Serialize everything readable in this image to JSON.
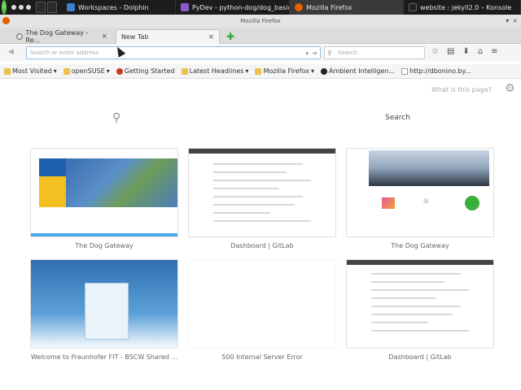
{
  "taskbar": {
    "tasks": [
      {
        "label": "Workspaces - Dolphin",
        "color": "#3f7fd0"
      },
      {
        "label": "PyDev - python-dog/dog_basic",
        "color": "#8a5ad0"
      },
      {
        "label": "Mozilla Firefox",
        "color": "#e66000",
        "active": true
      },
      {
        "label": "website : jekyll2.0 – Konsole",
        "color": "#222222"
      }
    ]
  },
  "window": {
    "title": "Mozilla Firefox"
  },
  "tabs": [
    {
      "label": "The Dog Gateway - Re...",
      "close": "×"
    },
    {
      "label": "New Tab",
      "close": "×"
    }
  ],
  "newtab_symbol": "✚",
  "navbar": {
    "url_placeholder": "Search or enter address",
    "search_placeholder": "Search"
  },
  "bookmarks": [
    {
      "label": "Most Visited",
      "icon": "folder",
      "dropdown": "▾"
    },
    {
      "label": "openSUSE",
      "icon": "folder",
      "dropdown": "▾"
    },
    {
      "label": "Getting Started",
      "icon": "red"
    },
    {
      "label": "Latest Headlines",
      "icon": "folder",
      "dropdown": "▾"
    },
    {
      "label": "Mozilla Firefox",
      "icon": "folder",
      "dropdown": "▾"
    },
    {
      "label": "Ambient Intelligen...",
      "icon": "gh"
    },
    {
      "label": "http://dbonino.by...",
      "icon": "page"
    }
  ],
  "newtab": {
    "whatis": "What is this page?",
    "search_label": "Search",
    "tiles": [
      {
        "label": "The Dog Gateway"
      },
      {
        "label": "Dashboard | GitLab"
      },
      {
        "label": "The Dog Gateway"
      },
      {
        "label": "Welcome to Fraunhofer FIT - BSCW Shared ..."
      },
      {
        "label": "500 Internal Server Error"
      },
      {
        "label": "Dashboard | GitLab"
      }
    ]
  }
}
